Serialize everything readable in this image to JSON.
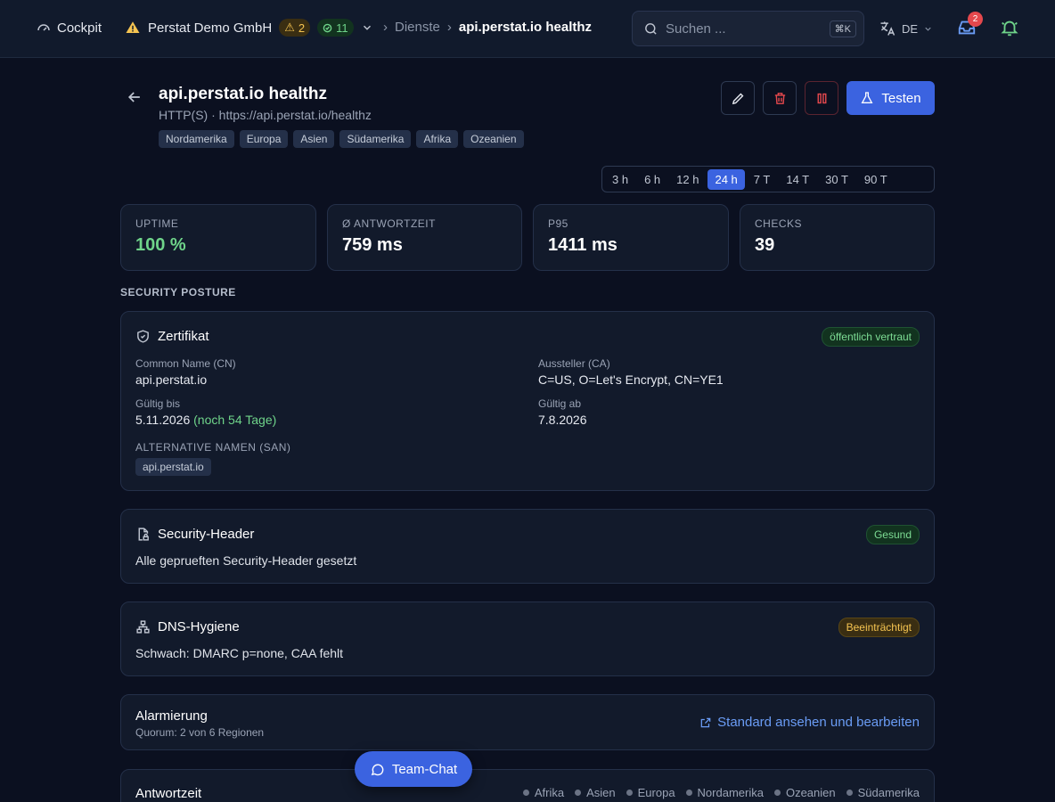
{
  "topbar": {
    "cockpit_label": "Cockpit",
    "org_name": "Perstat Demo GmbH",
    "warn_count": "2",
    "ok_count": "11",
    "breadcrumb_parent": "Dienste",
    "breadcrumb_current": "api.perstat.io healthz",
    "search_placeholder": "Suchen ...",
    "search_shortcut": "⌘K",
    "language": "DE",
    "inbox_count": "2"
  },
  "header": {
    "title": "api.perstat.io healthz",
    "subtitle": "HTTP(S) · https://api.perstat.io/healthz",
    "regions": [
      "Nordamerika",
      "Europa",
      "Asien",
      "Südamerika",
      "Afrika",
      "Ozeanien"
    ],
    "test_label": "Testen"
  },
  "time_ranges": {
    "options": [
      "3 h",
      "6 h",
      "12 h",
      "24 h",
      "7 T",
      "14 T",
      "30 T",
      "90 T"
    ],
    "selected": "24 h"
  },
  "stats": [
    {
      "label": "UPTIME",
      "value": "100 %"
    },
    {
      "label": "Ø ANTWORTZEIT",
      "value": "759 ms"
    },
    {
      "label": "P95",
      "value": "1411 ms"
    },
    {
      "label": "CHECKS",
      "value": "39"
    }
  ],
  "security": {
    "section_title": "SECURITY POSTURE",
    "certificate": {
      "title": "Zertifikat",
      "status": "öffentlich vertraut",
      "cn_label": "Common Name (CN)",
      "cn_value": "api.perstat.io",
      "issuer_label": "Aussteller (CA)",
      "issuer_value": "C=US, O=Let's Encrypt, CN=YE1",
      "valid_until_label": "Gültig bis",
      "valid_until_value": "5.11.2026",
      "valid_until_note": "(noch 54 Tage)",
      "valid_from_label": "Gültig ab",
      "valid_from_value": "7.8.2026",
      "san_label": "ALTERNATIVE NAMEN (SAN)",
      "san_values": [
        "api.perstat.io"
      ]
    },
    "headers": {
      "title": "Security-Header",
      "status": "Gesund",
      "text": "Alle geprueften Security-Header gesetzt"
    },
    "dns": {
      "title": "DNS-Hygiene",
      "status": "Beeinträchtigt",
      "text": "Schwach: DMARC p=none, CAA fehlt"
    }
  },
  "alerting": {
    "title": "Alarmierung",
    "subtitle": "Quorum: 2 von 6 Regionen",
    "link_label": "Standard ansehen und bearbeiten"
  },
  "response": {
    "title": "Antwortzeit",
    "legend": [
      "Afrika",
      "Asien",
      "Europa",
      "Nordamerika",
      "Ozeanien",
      "Südamerika"
    ]
  },
  "chat": {
    "label": "Team-Chat"
  },
  "colors": {
    "accent": "#3b63e0",
    "success": "#6fd48a",
    "warning": "#f5c451",
    "danger": "#e5484d"
  }
}
